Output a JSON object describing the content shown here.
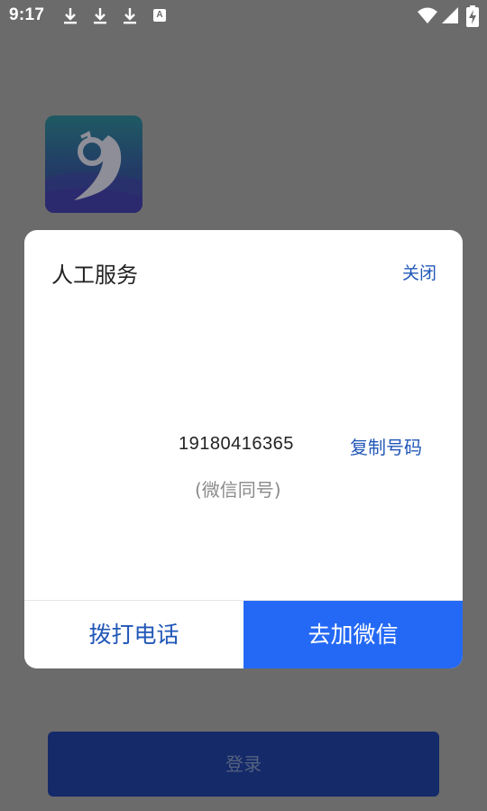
{
  "status_bar": {
    "time": "9:17",
    "notification_icons": [
      "download-icon",
      "download-icon",
      "download-icon",
      "a-icon"
    ],
    "a_icon_label": "A",
    "right_icons": [
      "wifi-icon",
      "signal-icon",
      "battery-charging-icon"
    ]
  },
  "background_app": {
    "logo_icon": "app-logo-icon",
    "login_label": "登录"
  },
  "dialog": {
    "title": "人工服务",
    "close_label": "关闭",
    "phone_number": "19180416365",
    "copy_label": "复制号码",
    "note": "(微信同号)",
    "call_label": "拨打电话",
    "wechat_label": "去加微信"
  },
  "colors": {
    "scrim": "#6b6b6b",
    "accent_text": "#2157b8",
    "primary_button": "#2469f5",
    "login_button": "#142a69"
  }
}
